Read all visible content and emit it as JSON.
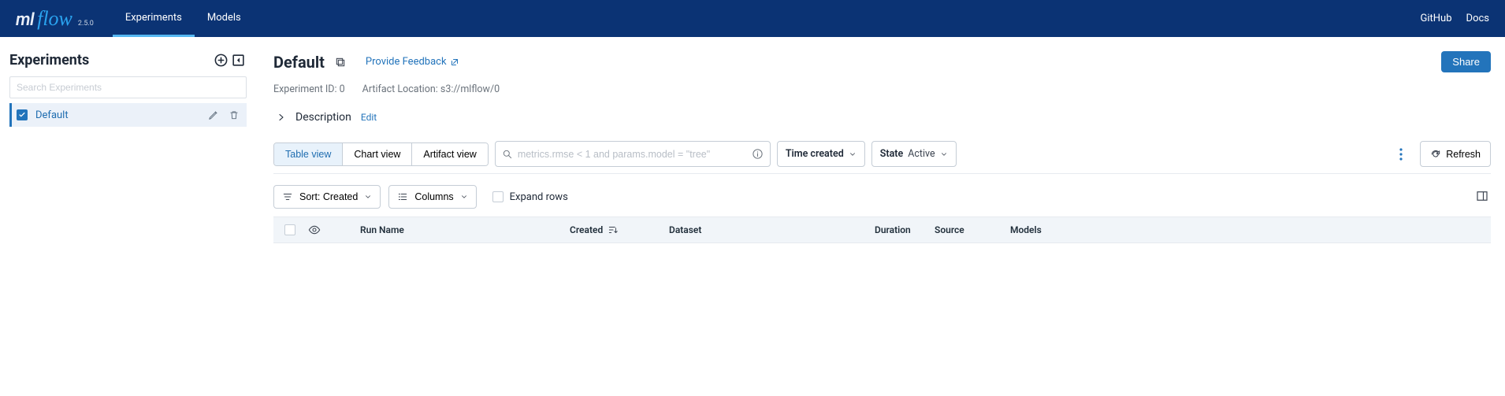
{
  "logo": {
    "ml": "ml",
    "flow": "flow",
    "version": "2.5.0"
  },
  "nav": {
    "tabs": [
      {
        "label": "Experiments",
        "active": true
      },
      {
        "label": "Models",
        "active": false
      }
    ],
    "right": {
      "github": "GitHub",
      "docs": "Docs"
    }
  },
  "sidebar": {
    "title": "Experiments",
    "search_placeholder": "Search Experiments",
    "items": [
      {
        "label": "Default",
        "checked": true
      }
    ]
  },
  "experiment": {
    "title": "Default",
    "feedback_label": "Provide Feedback",
    "share_label": "Share",
    "id_label": "Experiment ID: 0",
    "artifact_label": "Artifact Location: s3://mlflow/0",
    "description_label": "Description",
    "edit_label": "Edit"
  },
  "views": {
    "tabs": [
      "Table view",
      "Chart view",
      "Artifact view"
    ],
    "search_placeholder": "metrics.rmse < 1 and params.model = \"tree\"",
    "sort_key": "Time created",
    "state_key": "State",
    "state_val": "Active",
    "refresh": "Refresh"
  },
  "toolbar2": {
    "sort_label": "Sort: Created",
    "columns_label": "Columns",
    "expand_label": "Expand rows"
  },
  "columns": {
    "run_name": "Run Name",
    "created": "Created",
    "dataset": "Dataset",
    "duration": "Duration",
    "source": "Source",
    "models": "Models"
  }
}
